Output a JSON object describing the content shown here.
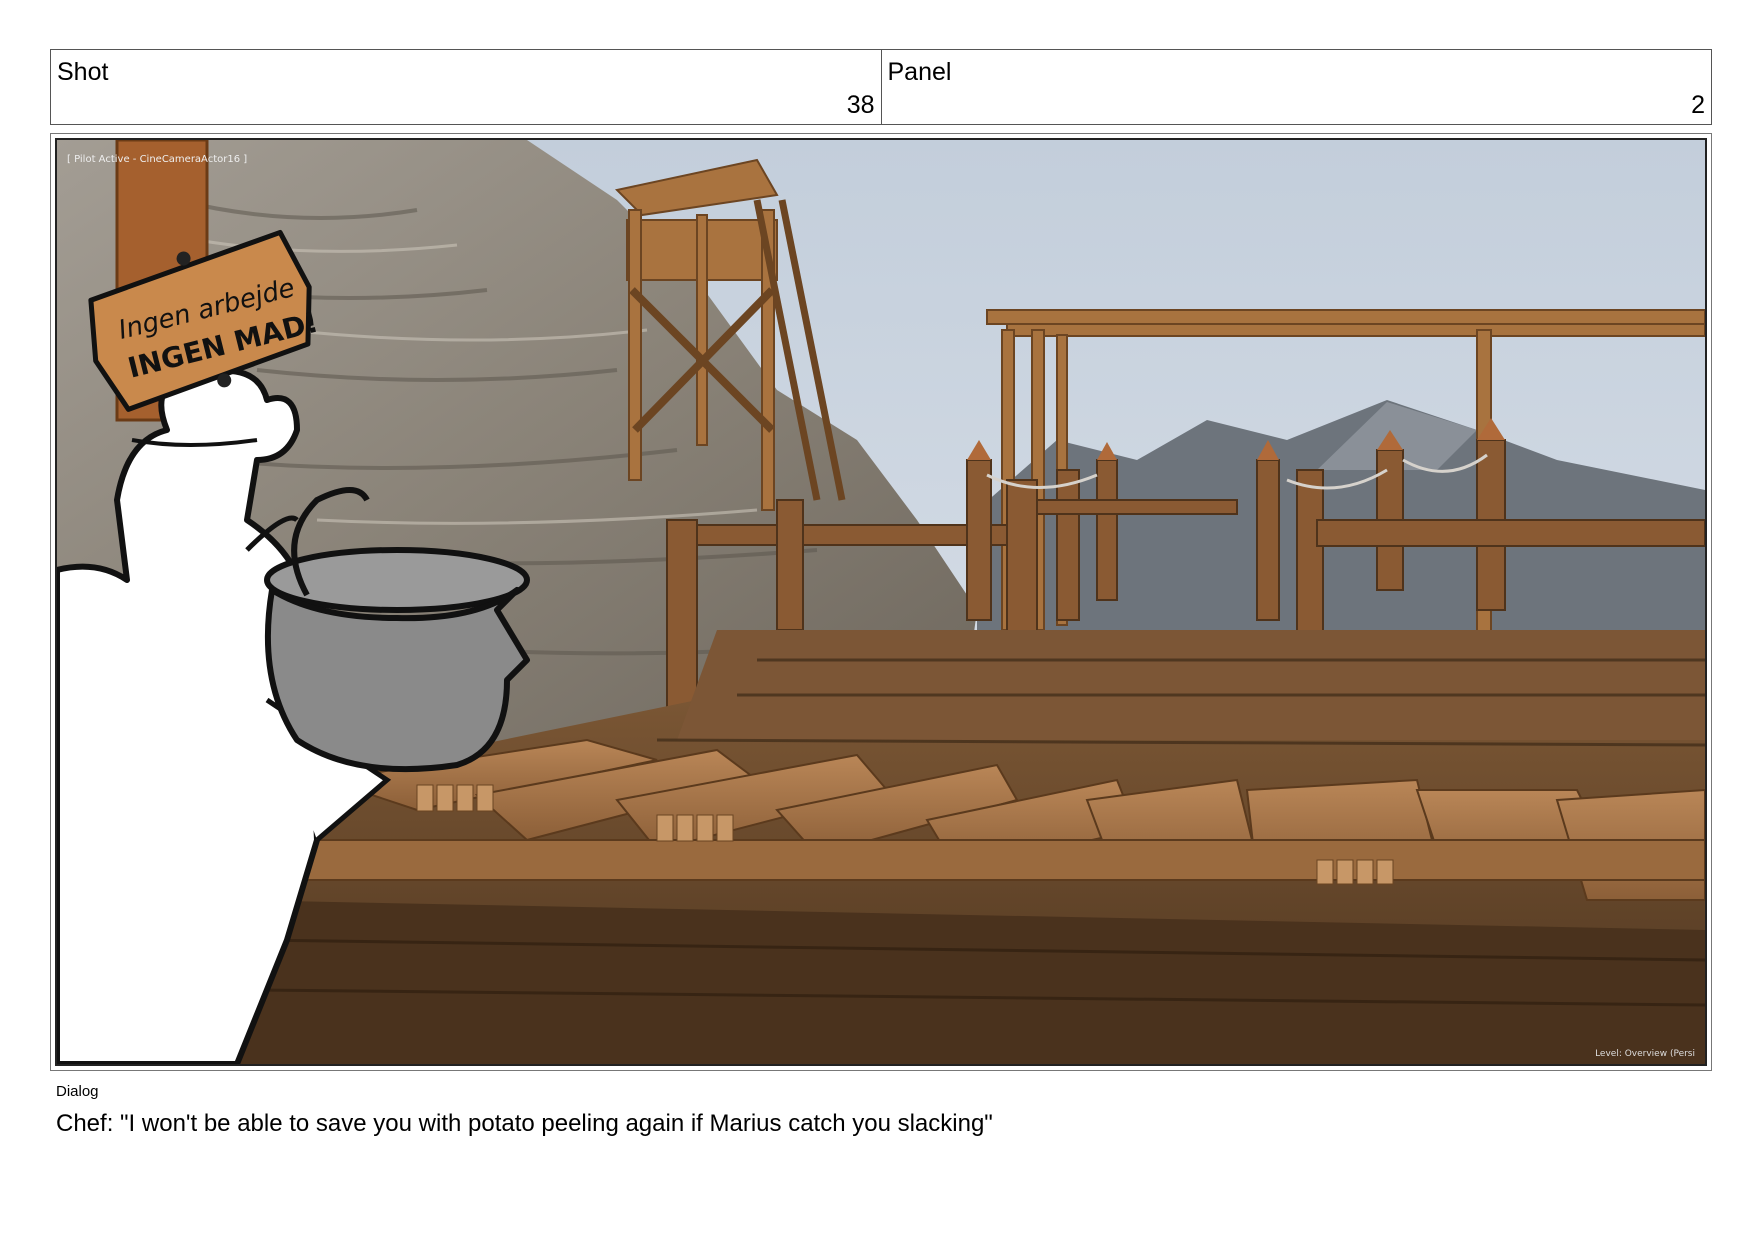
{
  "header": {
    "shot_label": "Shot",
    "shot_number": "38",
    "panel_label": "Panel",
    "panel_number": "2"
  },
  "frame": {
    "viewport_tag": "[ Pilot Active - CineCameraActor16 ]",
    "viewport_level": "Level: Overview (Persi",
    "sign_line1": "Ingen arbejde",
    "sign_line2": "INGEN MAD!"
  },
  "dialog": {
    "label": "Dialog",
    "text": "Chef: \"I won't be able to save you with potato peeling again if Marius catch you slacking\""
  }
}
